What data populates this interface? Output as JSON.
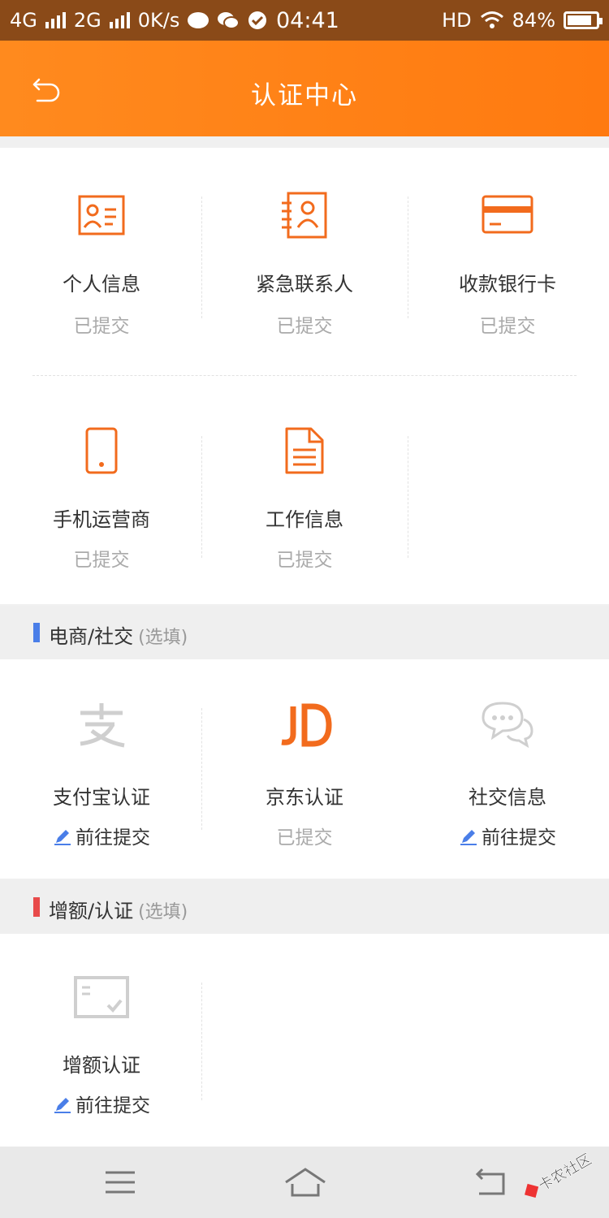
{
  "status_bar": {
    "network1": "4G",
    "network2": "2G",
    "speed": "0K/s",
    "time": "04:41",
    "hd": "HD",
    "battery": "84%"
  },
  "header": {
    "title": "认证中心",
    "back_icon": "back-arrow-icon"
  },
  "required": {
    "items": [
      {
        "name": "个人信息",
        "status": "已提交",
        "icon": "id-card-icon"
      },
      {
        "name": "紧急联系人",
        "status": "已提交",
        "icon": "contact-book-icon"
      },
      {
        "name": "收款银行卡",
        "status": "已提交",
        "icon": "bank-card-icon"
      },
      {
        "name": "手机运营商",
        "status": "已提交",
        "icon": "mobile-phone-icon"
      },
      {
        "name": "工作信息",
        "status": "已提交",
        "icon": "document-icon"
      }
    ]
  },
  "ecommerce": {
    "title": "电商/社交",
    "optional": "(选填)",
    "bar_color": "#4a7ee8",
    "items": [
      {
        "name": "支付宝认证",
        "status": "前往提交",
        "icon": "alipay-icon"
      },
      {
        "name": "京东认证",
        "status": "已提交",
        "icon": "jd-icon"
      },
      {
        "name": "社交信息",
        "status": "前往提交",
        "icon": "chat-bubbles-icon"
      }
    ]
  },
  "increase": {
    "title": "增额/认证",
    "optional": "(选填)",
    "bar_color": "#e84a4a",
    "items": [
      {
        "name": "增额认证",
        "status": "前往提交",
        "icon": "verify-card-icon"
      }
    ]
  },
  "colors": {
    "accent": "#f26b1d",
    "submitted": "#aaaaaa",
    "pencil": "#4a7ee8"
  }
}
